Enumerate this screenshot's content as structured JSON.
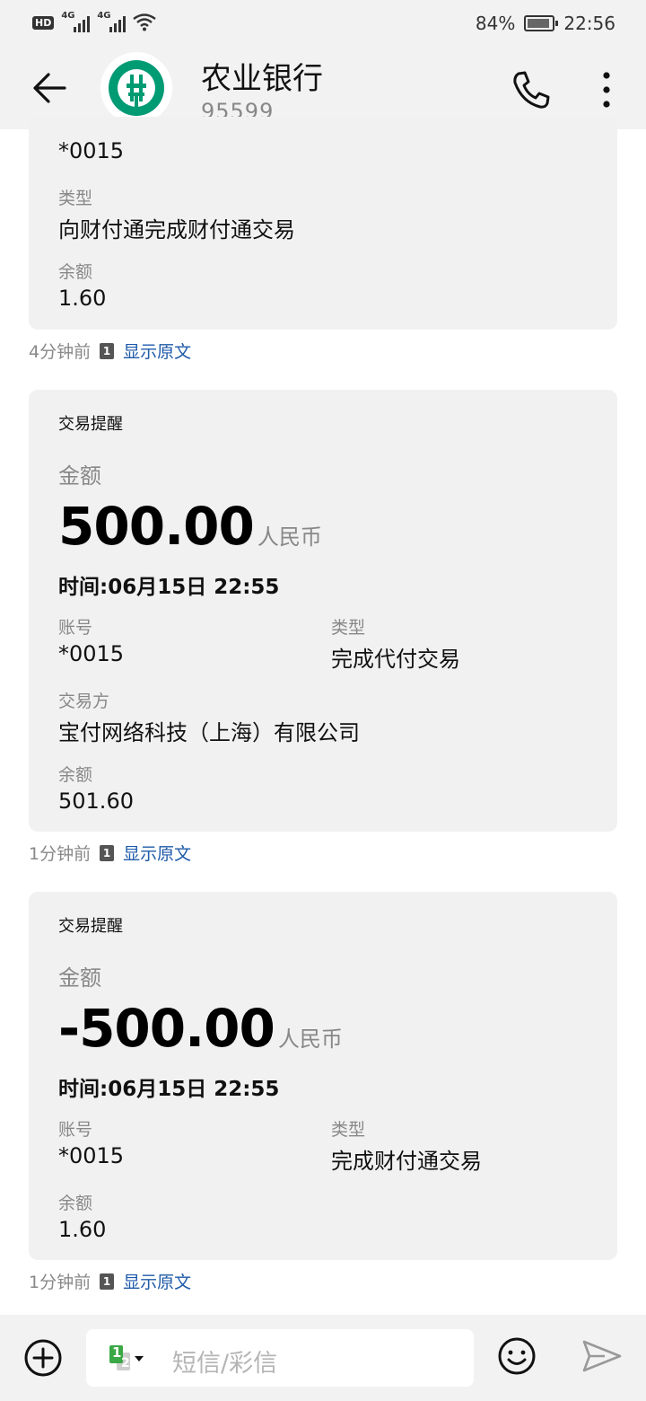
{
  "status": {
    "hd": "HD",
    "net1": "4G",
    "net2": "4G",
    "battery": "84%",
    "time": "22:56"
  },
  "header": {
    "title": "农业银行",
    "number": "95599"
  },
  "messages": [
    {
      "partial": true,
      "account": "*0015",
      "type_label": "类型",
      "type": "向财付通完成财付通交易",
      "balance_label": "余额",
      "balance": "1.60",
      "ago": "4分钟前",
      "sim": "1",
      "show_original": "显示原文"
    },
    {
      "head": "交易提醒",
      "amount_label": "金额",
      "amount": "500.00",
      "currency": "人民币",
      "time": "时间:06月15日 22:55",
      "account_label": "账号",
      "account": "*0015",
      "type_label": "类型",
      "type": "完成代付交易",
      "party_label": "交易方",
      "party": "宝付网络科技（上海）有限公司",
      "balance_label": "余额",
      "balance": "501.60",
      "ago": "1分钟前",
      "sim": "1",
      "show_original": "显示原文"
    },
    {
      "head": "交易提醒",
      "amount_label": "金额",
      "amount": "-500.00",
      "currency": "人民币",
      "time": "时间:06月15日 22:55",
      "account_label": "账号",
      "account": "*0015",
      "type_label": "类型",
      "type": "完成财付通交易",
      "balance_label": "余额",
      "balance": "1.60",
      "ago": "1分钟前",
      "sim": "1",
      "show_original": "显示原文"
    }
  ],
  "composer": {
    "sim_primary": "1",
    "sim_secondary": "2",
    "placeholder": "短信/彩信"
  },
  "colors": {
    "bank_green": "#009a73",
    "link_blue": "#1d5aa8",
    "bubble_bg": "#f1f1f1"
  }
}
